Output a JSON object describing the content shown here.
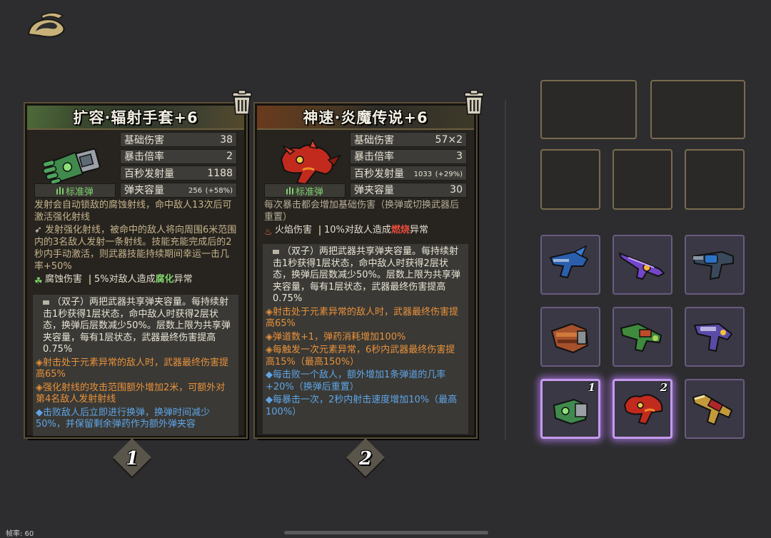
{
  "fps_label": "帧率: 60",
  "weapons": [
    {
      "title": "扩容·辐射手套+6",
      "ammo_type": "标准弹",
      "stats": [
        {
          "label": "基础伤害",
          "value": "38",
          "extra": ""
        },
        {
          "label": "暴击倍率",
          "value": "2",
          "extra": ""
        },
        {
          "label": "百秒发射量",
          "value": "1188",
          "extra": ""
        },
        {
          "label": "弹夹容量",
          "value": "256",
          "extra": "(+58%)"
        }
      ],
      "desc": "发射会自动锁敌的腐蚀射线，命中敌人13次后可激活强化射线",
      "desc2": "发射强化射线，被命中的敌人将向周围6米范围内的3名敌人发射一条射线。技能充能完成后的2秒内手动激活，则武器技能持续期间幸运一击几率+50%",
      "element": {
        "name": "腐蚀伤害",
        "effect_prefix": "5%对敌人造成",
        "effect_keyword": "腐化",
        "effect_suffix": "异常"
      },
      "twin_text": "（双子）两把武器共享弹夹容量。每持续射击1秒获得1层状态，命中敌人时获得2层状态，换弹后层数减少50%。层数上限为共享弹夹容量，每有1层状态，武器最终伤害提高0.75%",
      "perks": [
        {
          "text": "◈射击处于元素异常的敌人时，武器最终伤害提高65%",
          "color": "orange"
        },
        {
          "text": "◈强化射线的攻击范围额外增加2米，可额外对第4名敌人发射射线",
          "color": "orange"
        },
        {
          "text": "◆击败敌人后立即进行换弹，换弹时间减少50%，并保留剩余弹药作为额外弹夹容",
          "color": "blue"
        }
      ],
      "badge": "1"
    },
    {
      "title": "神速·炎魔传说+6",
      "ammo_type": "标准弹",
      "stats": [
        {
          "label": "基础伤害",
          "value": "57×2",
          "extra": ""
        },
        {
          "label": "暴击倍率",
          "value": "3",
          "extra": ""
        },
        {
          "label": "百秒发射量",
          "value": "1033",
          "extra": "(+29%)"
        },
        {
          "label": "弹夹容量",
          "value": "30",
          "extra": ""
        }
      ],
      "desc": "每次暴击都会增加基础伤害（换弹或切换武器后重置）",
      "element": {
        "name": "火焰伤害",
        "effect_prefix": "10%对敌人造成",
        "effect_keyword": "燃烧",
        "effect_suffix": "异常"
      },
      "twin_text": "（双子）两把武器共享弹夹容量。每持续射击1秒获得1层状态，命中敌人时获得2层状态，换弹后层数减少50%。层数上限为共享弹夹容量，每有1层状态，武器最终伤害提高0.75%",
      "perks": [
        {
          "text": "◈射击处于元素异常的敌人时，武器最终伤害提高65%",
          "color": "orange"
        },
        {
          "text": "◈弹道数+1，弹药消耗增加100%",
          "color": "orange"
        },
        {
          "text": "◈每触发一次元素异常，6秒内武器最终伤害提高15%（最高150%）",
          "color": "orange"
        },
        {
          "text": "◆每击败一个敌人，额外增加1条弹道的几率+20%（换弹后重置）",
          "color": "blue"
        },
        {
          "text": "◆每暴击一次，2秒内射击速度增加10%（最高100%）",
          "color": "blue"
        }
      ],
      "badge": "2"
    }
  ],
  "inventory": [
    {
      "icon": "blue-winged-pistol-icon",
      "tag": ""
    },
    {
      "icon": "purple-laser-rifle-icon",
      "tag": ""
    },
    {
      "icon": "blue-revolver-icon",
      "tag": ""
    },
    {
      "icon": "bronze-gauntlet-icon",
      "tag": ""
    },
    {
      "icon": "green-launcher-icon",
      "tag": ""
    },
    {
      "icon": "purple-smg-icon",
      "tag": ""
    },
    {
      "icon": "green-radiation-glove-icon",
      "tag": "1"
    },
    {
      "icon": "red-dragon-gun-icon",
      "tag": "2"
    },
    {
      "icon": "golden-shotgun-icon",
      "tag": ""
    }
  ],
  "colors": {
    "orange_perk": "#e8913b",
    "blue_perk": "#5ea5e8",
    "selected_glow": "#c59bef",
    "ammo_green": "#7fd06e"
  }
}
